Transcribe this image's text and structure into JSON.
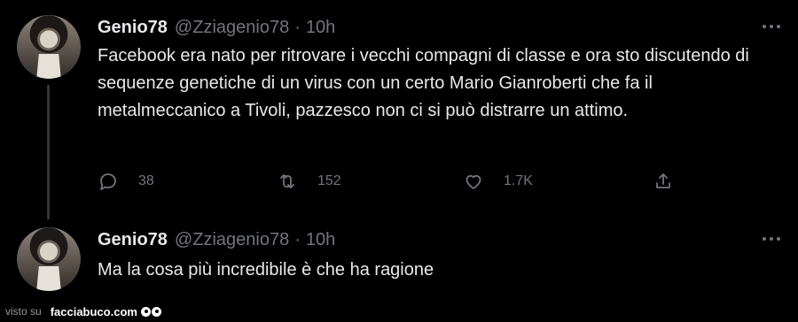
{
  "tweets": [
    {
      "name": "Genio78",
      "handle": "@Zziagenio78",
      "separator": "·",
      "time": "10h",
      "text": "Facebook era nato per ritrovare i vecchi compagni di classe e ora sto discutendo di sequenze genetiche di un virus con un certo Mario Gianroberti che fa il metalmeccanico a Tivoli, pazzesco non ci si può distrarre un attimo.",
      "actions": {
        "replies": "38",
        "retweets": "152",
        "likes": "1.7K"
      }
    },
    {
      "name": "Genio78",
      "handle": "@Zziagenio78",
      "separator": "·",
      "time": "10h",
      "text": "Ma la cosa più incredibile è che ha ragione"
    }
  ],
  "icons": {
    "reply": "speech-bubble-icon",
    "retweet": "retweet-icon",
    "like": "heart-icon",
    "share": "share-icon",
    "more": "more-horizontal-icon"
  },
  "colors": {
    "background": "#000000",
    "text": "#e7e9ea",
    "muted": "#71767b",
    "thread_line": "#333639"
  },
  "footer": {
    "prefix": "visto su",
    "site": "facciabuco.com"
  }
}
